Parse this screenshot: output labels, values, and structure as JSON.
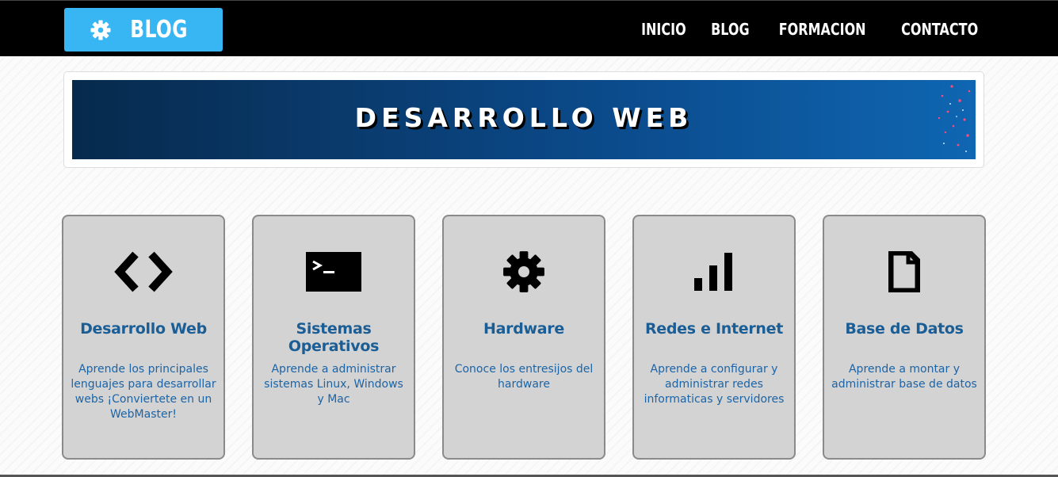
{
  "brand": {
    "logo_label": "BLOG",
    "accent": "#38b6f4"
  },
  "nav": {
    "items": [
      {
        "label": "INICIO"
      },
      {
        "label": "BLOG"
      },
      {
        "label": "FORMACION"
      },
      {
        "label": "CONTACTO"
      }
    ]
  },
  "banner": {
    "title": "DESARROLLO WEB"
  },
  "cards": [
    {
      "icon": "code-icon",
      "title": "Desarrollo Web",
      "description": "Aprende los principales lenguajes para desarrollar webs ¡Conviertete en un WebMaster!"
    },
    {
      "icon": "terminal-icon",
      "title": "Sistemas Operativos",
      "description": "Aprende a administrar sistemas Linux, Windows y Mac"
    },
    {
      "icon": "gear-icon",
      "title": "Hardware",
      "description": "Conoce los entresijos del hardware"
    },
    {
      "icon": "signal-bars-icon",
      "title": "Redes e Internet",
      "description": "Aprende a configurar y administrar redes informaticas y servidores"
    },
    {
      "icon": "document-icon",
      "title": "Base de Datos",
      "description": "Aprende a montar y administrar base de datos"
    }
  ],
  "colors": {
    "navbar_bg": "#000000",
    "card_bg": "#d3d3d3",
    "card_title": "#1b5d95",
    "card_text": "#1c64a6"
  }
}
